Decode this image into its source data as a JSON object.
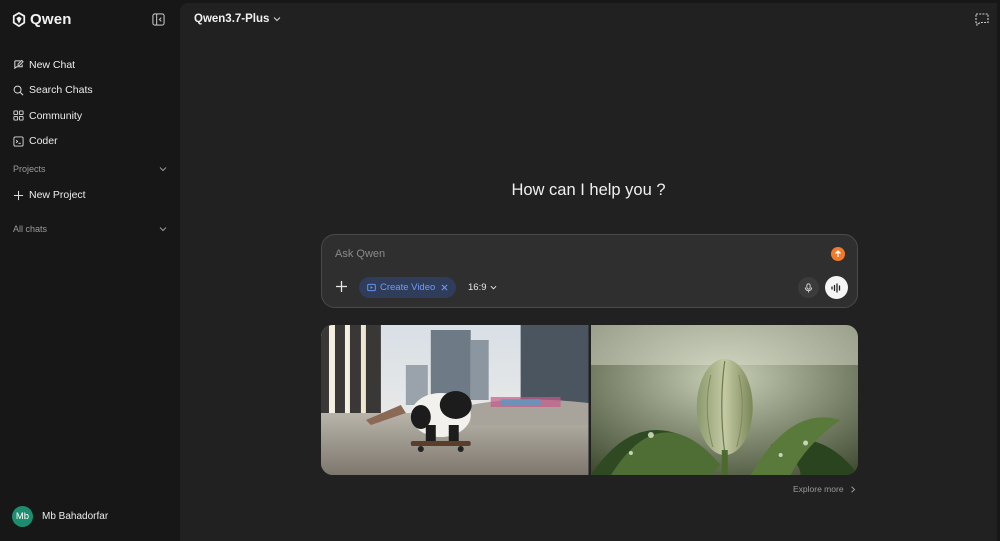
{
  "brand": {
    "name": "Qwen"
  },
  "sidebar": {
    "nav": [
      {
        "label": "New Chat",
        "icon": "new-chat-icon"
      },
      {
        "label": "Search Chats",
        "icon": "search-icon"
      },
      {
        "label": "Community",
        "icon": "grid-icon"
      },
      {
        "label": "Coder",
        "icon": "terminal-icon"
      }
    ],
    "projects_label": "Projects",
    "new_project_label": "New Project",
    "all_chats_label": "All chats"
  },
  "user": {
    "initials": "Mb",
    "name": "Mb Bahadorfar",
    "avatar_color": "#1e8c6e"
  },
  "header": {
    "model": "Qwen3.7-Plus"
  },
  "main": {
    "heading": "How can I help you ?",
    "composer": {
      "placeholder": "Ask Qwen",
      "chip_label": "Create Video",
      "aspect_ratio": "16:9"
    },
    "gallery": [
      {
        "subject": "panda riding a skateboard in a city skatepark"
      },
      {
        "subject": "flower bud with dew drops"
      }
    ],
    "explore_label": "Explore more"
  },
  "colors": {
    "accent": "#f07a2a",
    "chip_text": "#6f9bff",
    "background": "#212121",
    "sidebar": "#171717"
  }
}
